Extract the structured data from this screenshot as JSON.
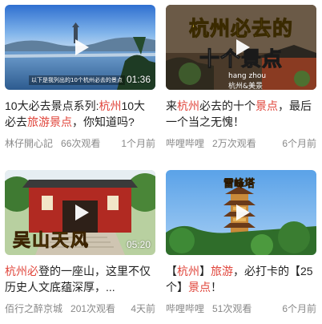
{
  "colors": {
    "highlight": "#e0443a",
    "meta": "#888888",
    "title": "#222222"
  },
  "cards": [
    {
      "duration": "01:36",
      "thumb_caption": "以下是我列出的10个杭州必去的景点",
      "title_parts": [
        {
          "text": "10大必去景点系列:",
          "hl": false
        },
        {
          "text": "杭州",
          "hl": true
        },
        {
          "text": "10大必去",
          "hl": false
        },
        {
          "text": "旅游",
          "hl": true
        },
        {
          "text": "景点",
          "hl": true
        },
        {
          "text": "，你知道吗?",
          "hl": false
        }
      ],
      "author": "林仔開心記",
      "views": "66次观看",
      "ago": "1个月前"
    },
    {
      "duration": "",
      "thumb_line1": "杭州必去的",
      "thumb_line2": "十个景点",
      "thumb_tag1": "hang zhou",
      "thumb_tag2": "杭州&美景",
      "title_parts": [
        {
          "text": "来",
          "hl": false
        },
        {
          "text": "杭州",
          "hl": true
        },
        {
          "text": "必去的十个",
          "hl": false
        },
        {
          "text": "景点",
          "hl": true
        },
        {
          "text": "，最后一个当之无愧！",
          "hl": false
        }
      ],
      "author": "哔哩哔哩",
      "views": "2万次观看",
      "ago": "6个月前"
    },
    {
      "duration": "05:20",
      "thumb_text": "吴山天风",
      "title_parts": [
        {
          "text": "杭州必",
          "hl": true
        },
        {
          "text": "登的一座山，这里不仅历史人文底蕴深厚，...",
          "hl": false
        }
      ],
      "author": "佰行之醉京城",
      "views": "201次观看",
      "ago": "4天前"
    },
    {
      "duration": "",
      "thumb_text": "雷峰塔",
      "title_parts": [
        {
          "text": "【",
          "hl": false
        },
        {
          "text": "杭州",
          "hl": true
        },
        {
          "text": "】",
          "hl": false
        },
        {
          "text": "旅游",
          "hl": true
        },
        {
          "text": "，必打卡的【25个】",
          "hl": false
        },
        {
          "text": "景点",
          "hl": true
        },
        {
          "text": "！",
          "hl": false
        }
      ],
      "author": "哔哩哔哩",
      "views": "51次观看",
      "ago": "6个月前"
    }
  ]
}
